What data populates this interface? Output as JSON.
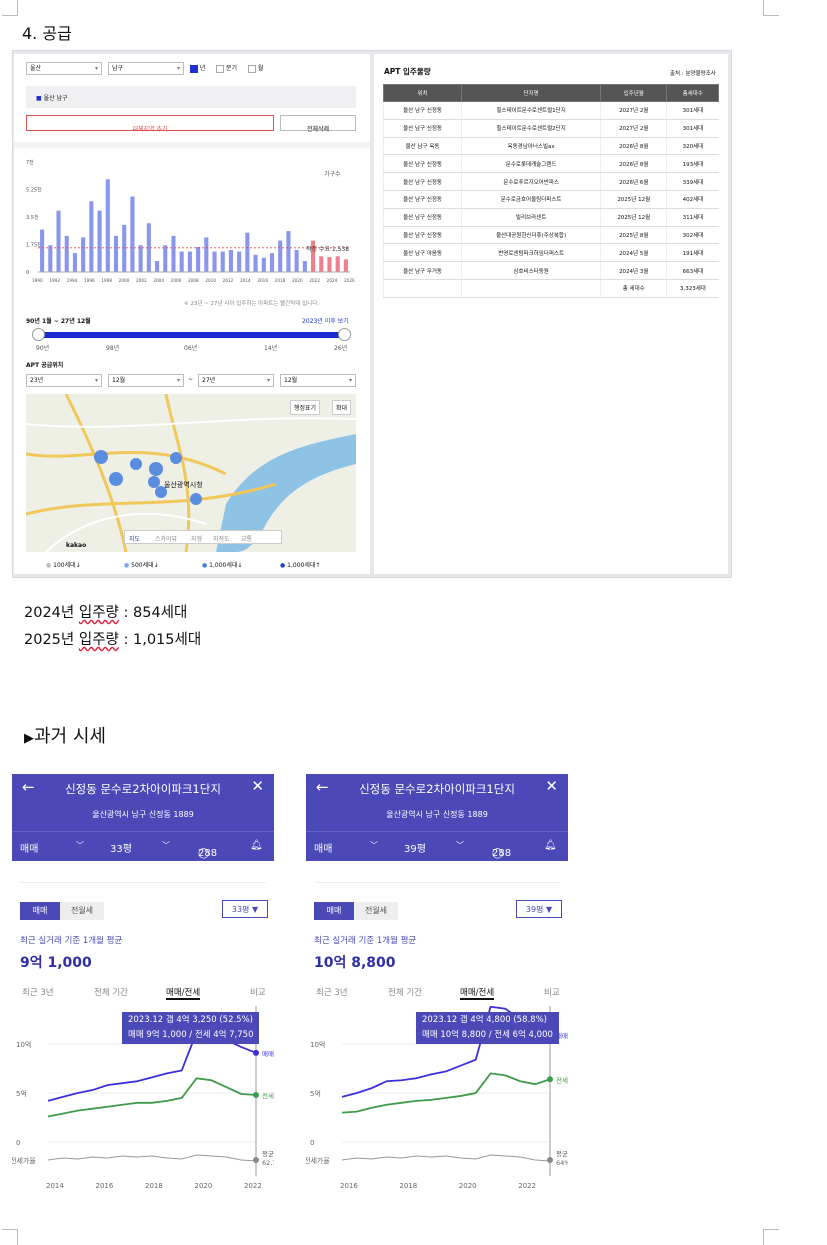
{
  "section_title": "4. 공급",
  "supply": {
    "region_select": "울산",
    "district_select": "남구",
    "period_options": [
      "년",
      "분기",
      "월"
    ],
    "selected_region": "울산 남구",
    "add_region_button": "대체지역 추가",
    "clear_button": "전체삭제",
    "chart_unit": "가구수",
    "legend_note": "적정 수요 1,538",
    "footnote": "※ 23년 ~ 27년 사이 입주하는 아파트는 빨간막대 입니다.",
    "range_label": "90년 1월 ~ 27년 12월",
    "after_link": "2023년 이후 보기",
    "slider_ticks": [
      "90년",
      "98년",
      "06년",
      "14년",
      "26년"
    ],
    "location_title": "APT 공급위치",
    "from_year": "23년",
    "from_month": "12월",
    "tilde": "~",
    "to_year": "27년",
    "to_month": "12월",
    "map_buttons": [
      "행정표기",
      "확대"
    ],
    "map_labels": [
      "울산광역시청",
      "kakao"
    ],
    "map_modes": [
      "지도",
      "스카이뷰",
      "지형",
      "지적도",
      "교통"
    ],
    "map_legend": [
      "100세대↓",
      "500세대↓",
      "1,000세대↓",
      "1,000세대↑"
    ]
  },
  "chart_data": {
    "type": "bar",
    "title": "",
    "ylabel": "가구수",
    "y_ticks": [
      "0",
      "1.75천",
      "3.5천",
      "5.25천",
      "7천"
    ],
    "ylim": [
      0,
      7000
    ],
    "x_ticks": [
      "1990",
      "1992",
      "1994",
      "1996",
      "1998",
      "2000",
      "2002",
      "2004",
      "2006",
      "2008",
      "2010",
      "2012",
      "2014",
      "2016",
      "2018",
      "2020",
      "2022",
      "2024",
      "2026"
    ],
    "categories": [
      "1990",
      "1991",
      "1992",
      "1993",
      "1994",
      "1995",
      "1996",
      "1997",
      "1998",
      "1999",
      "2000",
      "2001",
      "2002",
      "2003",
      "2004",
      "2005",
      "2006",
      "2007",
      "2008",
      "2009",
      "2010",
      "2011",
      "2012",
      "2013",
      "2014",
      "2015",
      "2016",
      "2017",
      "2018",
      "2019",
      "2020",
      "2021",
      "2022",
      "2023",
      "2024",
      "2025",
      "2026",
      "2027"
    ],
    "series": [
      {
        "values": [
          2700,
          1700,
          3900,
          2300,
          1200,
          2200,
          4500,
          3900,
          5900,
          2300,
          3000,
          4800,
          1700,
          3100,
          700,
          1700,
          2300,
          1300,
          1300,
          1600,
          2200,
          1300,
          1300,
          1400,
          1300,
          2500,
          1100,
          900,
          1200,
          2000,
          2600,
          1400,
          700,
          2000,
          1000,
          950,
          1000,
          800
        ]
      }
    ],
    "demand_line": 1538
  },
  "apt_table": {
    "title": "APT 입주물량",
    "source": "출처 : 분양물량조사",
    "headers": [
      "위치",
      "단지명",
      "입주년월",
      "총세대수"
    ],
    "rows": [
      [
        "울산 남구 신정동",
        "힐스테이트문수로센트럴1단지",
        "2027년 2월",
        "301세대"
      ],
      [
        "울산 남구 신정동",
        "힐스테이트문수로센트럴2단지",
        "2027년 2월",
        "301세대"
      ],
      [
        "울산 남구 옥동",
        "옥동경남아너스빌ax",
        "2026년 8월",
        "320세대"
      ],
      [
        "울산 남구 신정동",
        "문수로롯데캐슬그랜드",
        "2026년 8월",
        "193세대"
      ],
      [
        "울산 남구 신정동",
        "문수로푸르지오어반피스",
        "2026년 6월",
        "339세대"
      ],
      [
        "울산 남구 신정동",
        "문수로금호어울림더퍼스트",
        "2025년 12월",
        "402세대"
      ],
      [
        "울산 남구 신정동",
        "빌리브라센트",
        "2025년 12월",
        "311세대"
      ],
      [
        "울산 남구 신정동",
        "울산대공원한신더휴(주상복합)",
        "2025년 8월",
        "302세대"
      ],
      [
        "울산 남구 야음동",
        "번영로센텀파크하임더퍼스트",
        "2024년 5월",
        "191세대"
      ],
      [
        "울산 남구 무거동",
        "삼호비스타동원",
        "2024년 3월",
        "663세대"
      ]
    ],
    "total_label": "총 세대수",
    "total_value": "3,323세대"
  },
  "move_in": [
    "2024년 입주량 : 854세대",
    "2025년 입주량 : 1,015세대"
  ],
  "past_title": "과거 시세",
  "cards": [
    {
      "title": "신정동 문수로2차아이파크1단지",
      "address": "울산광역시 남구 신정동 1889",
      "deal": "매매",
      "size": "33평",
      "count": "288",
      "tab_sale": "매매",
      "tab_rent": "전월세",
      "size_btn": "33평 ▼",
      "caption": "최근 실거래 기준 1개월 평균",
      "price": "9억 1,000",
      "tabs": [
        "최근 3년",
        "전체 기간",
        "매매/전세",
        "비교"
      ],
      "tooltip1": "2023.12 갭 4억 3,250 (52.5%)",
      "tooltip2": "매매 9억 1,000 / 전세 4억 7,750",
      "y_ticks": [
        "15억",
        "10억",
        "5억",
        "0"
      ],
      "ratio_label": "전세가율",
      "x_ticks": [
        "2014",
        "2016",
        "2018",
        "2020",
        "2022"
      ],
      "end_labels": [
        "매매",
        "전세",
        "평균",
        "62.7%"
      ],
      "sale_series": [
        4.2,
        4.6,
        5.0,
        5.3,
        5.8,
        6.0,
        6.2,
        6.6,
        7.0,
        7.3,
        11.2,
        11.1,
        10.4,
        9.7,
        9.1
      ],
      "rent_series": [
        2.6,
        2.9,
        3.2,
        3.4,
        3.6,
        3.8,
        4.0,
        4.0,
        4.2,
        4.5,
        6.5,
        6.3,
        5.6,
        4.9,
        4.8
      ]
    },
    {
      "title": "신정동 문수로2차아이파크1단지",
      "address": "울산광역시 남구 신정동 1889",
      "deal": "매매",
      "size": "39평",
      "count": "288",
      "tab_sale": "매매",
      "tab_rent": "전월세",
      "size_btn": "39평 ▼",
      "caption": "최근 실거래 기준 1개월 평균",
      "price": "10억 8,800",
      "tabs": [
        "최근 3년",
        "전체 기간",
        "매매/전세",
        "비교"
      ],
      "tooltip1": "2023.12 갭 4억 4,800 (58.8%)",
      "tooltip2": "매매 10억 8,800 / 전세 6억 4,000",
      "y_ticks": [
        "15억",
        "10억",
        "5억",
        "0"
      ],
      "ratio_label": "전세가율",
      "x_ticks": [
        "2016",
        "2018",
        "2020",
        "2022"
      ],
      "end_labels": [
        "매매",
        "전세",
        "평균",
        "64%"
      ],
      "sale_series": [
        4.6,
        5.0,
        5.5,
        6.2,
        6.3,
        6.5,
        6.9,
        7.2,
        7.8,
        8.4,
        13.8,
        13.6,
        12.5,
        10.6,
        10.9
      ],
      "rent_series": [
        3.0,
        3.1,
        3.5,
        3.8,
        4.0,
        4.2,
        4.3,
        4.5,
        4.7,
        5.0,
        7.0,
        6.8,
        6.2,
        5.9,
        6.4
      ]
    }
  ]
}
